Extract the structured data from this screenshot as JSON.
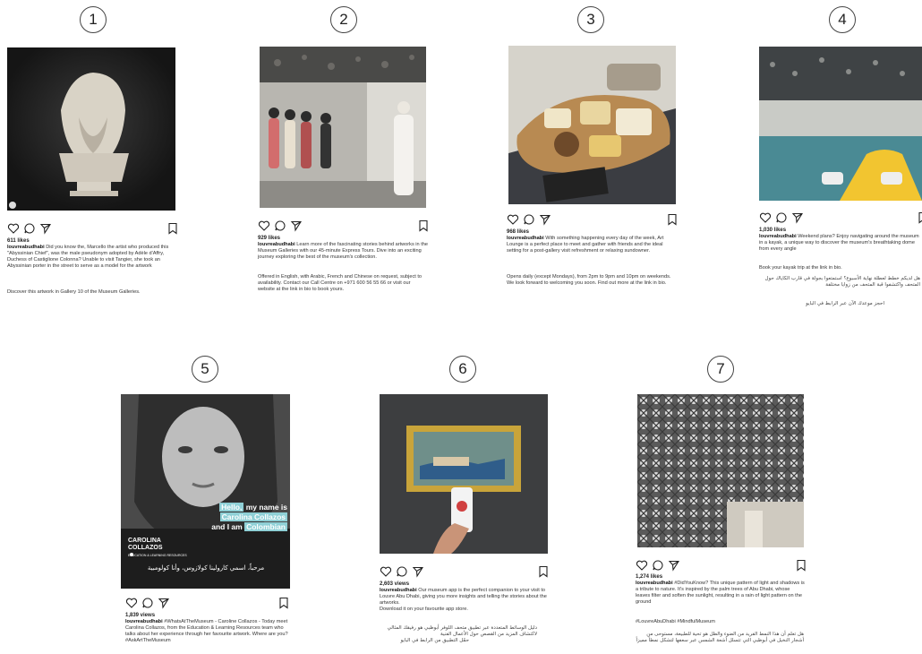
{
  "posts": [
    {
      "number": "1",
      "likes": "611 likes",
      "username": "louvreabudhabi",
      "caption": "Did you know the, Marcello the artist who produced this \"Abyssinian Chief\", was the male pseudonym adopted by Adèle d'Affry, Duchess of Castiglione Colonna? Unable to visit Tangier, she took an Abyssinian porter in the street to serve as a model for the artwork",
      "extra": "Discover this artwork in Gallery 10 of the Museum Galleries."
    },
    {
      "number": "2",
      "likes": "929 likes",
      "username": "louvreabudhabi",
      "caption": "Learn more of the fascinating stories behind artworks in the Museum Galleries with our 45-minute Express Tours. Dive into an exciting journey exploring the best of the museum's collection.",
      "extra": "Offered in English, with Arabic, French and Chinese on request, subject to availability. Contact our Call Centre on +971 600 56 55 66 or visit our website at the link in bio to book yours."
    },
    {
      "number": "3",
      "likes": "968 likes",
      "username": "louvreabudhabi",
      "caption": "With something happening every day of the week, Art Lounge is a perfect place to meet and gather with friends and the ideal setting for a post-gallery visit refreshment or relaxing sundowner.",
      "extra": "Opens daily (except Mondays), from 2pm to 9pm and 10pm on weekends. We look forward to welcoming you soon. Find out more at the link in bio."
    },
    {
      "number": "4",
      "likes": "1,030 likes",
      "username": "louvreabudhabi",
      "caption": "Weekend plans? Enjoy navigating around the museum in a kayak, a unique way to discover the museum's breathtaking dome from every angle",
      "extra": "Book your kayak trip at the link in bio.",
      "arabic": "هل لديكم خطط لعطلة نهاية الأسبوع؟ استمتعوا بجولة في قارب الكاياك حول المتحف واكتشفوا قبة المتحف من زوايا مختلفة",
      "arabic2": "احجز موعدك الآن عبر الرابط في البايو"
    },
    {
      "number": "5",
      "likes": "1,839 views",
      "username": "louvreabudhabi",
      "caption": "#WhatsAtTheMuseum - Caroline Collazos - Today meet Carolina Collazos, from the Education & Learning Resources team who talks about her experience through her favourite artwork. Where are you? #AskArtTheMuseum",
      "overlay_line1_hl": "Hello,",
      "overlay_line1_rest": " my name is",
      "overlay_line2": "Carolina Collazos",
      "overlay_line3_pre": "and I am ",
      "overlay_line3_hl": "Colombian",
      "name_line1": "CAROLINA",
      "name_line2": "COLLAZOS",
      "name_role": "EDUCATION & LEARNING RESOURCES",
      "subtitle_ar": "مرحباً، اسمي كارولينا كولازوس، وأنا كولومبية"
    },
    {
      "number": "6",
      "likes": "2,603 views",
      "username": "louvreabudhabi",
      "caption": "Our museum app is the perfect companion to your visit to Louvre Abu Dhabi, giving you more insights and telling the stories about the artworks.",
      "extra": "Download it on your favourite app store.",
      "arabic": "دليل الوسائط المتعددة عبر تطبيق متحف اللوفر أبوظبي هو رفيقك المثالي لاكتشاف المزيد من القصص حول الأعمال الفنية",
      "arabic2": "حمّل التطبيق من الرابط في البايو"
    },
    {
      "number": "7",
      "likes": "1,274 likes",
      "username": "louvreabudhabi",
      "caption": "#DidYouKnow? This unique pattern of light and shadows is a tribute to nature. It's inspired by the palm trees of Abu Dhabi, whose leaves filter and soften the sunlight, resulting in a rain of light pattern on the ground",
      "hashtags": "#LouvreAbuDhabi #MindfulMuseum",
      "arabic": "هل تعلم أن هذا النمط الفريد من الضوء والظل هو تحية للطبيعة، مستوحى من أشجار النخيل في أبوظبي التي تتسلل أشعة الشمس عبر سعفها لتشكل نمطاً مميزاً"
    }
  ],
  "icons": [
    "heart-icon",
    "comment-icon",
    "share-icon",
    "bookmark-icon"
  ]
}
